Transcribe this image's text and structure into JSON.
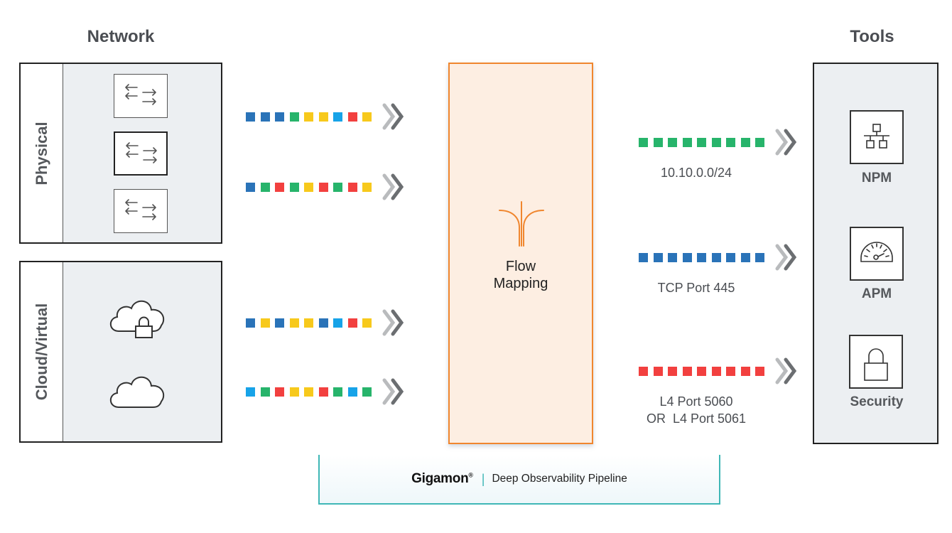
{
  "colors": {
    "blue": "#2a73b8",
    "green": "#27b46b",
    "yellow": "#f7c91c",
    "lightblue": "#17a3e8",
    "red": "#f2403f",
    "orange": "#f0862e",
    "teal": "#3fb7b6",
    "chevron_light": "#b9bbbd",
    "chevron_dark": "#6b6e71"
  },
  "network": {
    "title": "Network",
    "physical": {
      "label": "Physical",
      "devices": [
        "switch-icon",
        "switch-icon",
        "switch-icon"
      ]
    },
    "cloud": {
      "label": "Cloud/Virtual",
      "devices": [
        "secure-cloud-icon",
        "cloud-icon"
      ]
    }
  },
  "input_streams": [
    [
      "blue",
      "blue",
      "blue",
      "green",
      "yellow",
      "yellow",
      "lightblue",
      "red",
      "yellow"
    ],
    [
      "blue",
      "green",
      "red",
      "green",
      "yellow",
      "red",
      "green",
      "red",
      "yellow"
    ],
    [
      "blue",
      "yellow",
      "blue",
      "yellow",
      "yellow",
      "blue",
      "lightblue",
      "red",
      "yellow"
    ],
    [
      "lightblue",
      "green",
      "red",
      "yellow",
      "yellow",
      "red",
      "green",
      "lightblue",
      "green"
    ]
  ],
  "flow_mapping": {
    "line1": "Flow",
    "line2": "Mapping",
    "icon": "flow-mapping-icon"
  },
  "output_streams": [
    {
      "color": "green",
      "count": 9,
      "filter_lines": [
        "10.10.0.0/24"
      ]
    },
    {
      "color": "blue",
      "count": 9,
      "filter_lines": [
        "TCP Port 445"
      ]
    },
    {
      "color": "red",
      "count": 9,
      "filter_lines": [
        "L4 Port 5060",
        "OR  L4 Port 5061"
      ]
    }
  ],
  "tools": {
    "title": "Tools",
    "items": [
      {
        "label": "NPM",
        "icon": "network-topology-icon"
      },
      {
        "label": "APM",
        "icon": "gauge-icon"
      },
      {
        "label": "Security",
        "icon": "lock-icon"
      }
    ]
  },
  "pipeline": {
    "brand": "Gigamon",
    "registered": "®",
    "separator": "|",
    "tagline": "Deep Observability Pipeline"
  }
}
